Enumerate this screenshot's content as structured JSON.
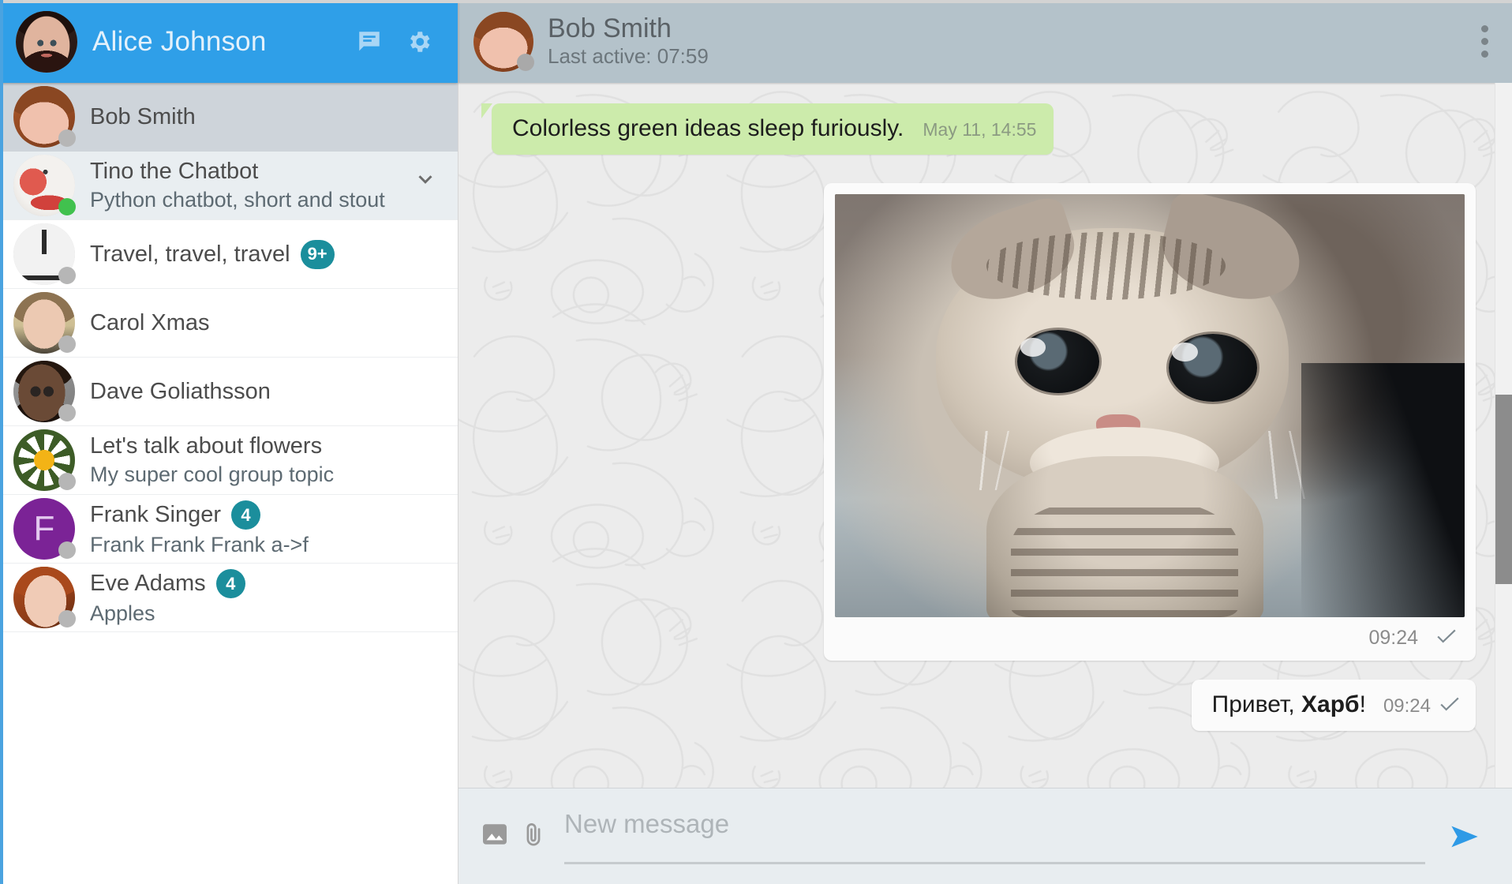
{
  "sidebar": {
    "header": {
      "user_name": "Alice Johnson",
      "new_chat_icon": "chat-bubble-icon",
      "settings_icon": "gear-icon"
    },
    "chats": [
      {
        "name": "Bob Smith",
        "subtitle": "",
        "badge": "",
        "status": "offline",
        "selected": true,
        "avatar_kind": "photo-bob",
        "chevron": false
      },
      {
        "name": "Tino the Chatbot",
        "subtitle": "Python chatbot, short and stout",
        "badge": "",
        "status": "online",
        "selected": false,
        "avatar_kind": "photo-clown",
        "chevron": true
      },
      {
        "name": "Travel, travel, travel",
        "subtitle": "",
        "badge": "9+",
        "status": "offline",
        "selected": false,
        "avatar_kind": "photo-eiffel",
        "chevron": false
      },
      {
        "name": "Carol Xmas",
        "subtitle": "",
        "badge": "",
        "status": "offline",
        "selected": false,
        "avatar_kind": "photo-carol",
        "chevron": false
      },
      {
        "name": "Dave Goliathsson",
        "subtitle": "",
        "badge": "",
        "status": "offline",
        "selected": false,
        "avatar_kind": "photo-dave",
        "chevron": false
      },
      {
        "name": "Let's talk about flowers",
        "subtitle": "My super cool group topic",
        "badge": "",
        "status": "offline",
        "selected": false,
        "avatar_kind": "photo-flower",
        "chevron": false
      },
      {
        "name": "Frank Singer",
        "subtitle": "Frank Frank Frank a->f",
        "badge": "4",
        "status": "offline",
        "selected": false,
        "avatar_kind": "letter-F",
        "chevron": false
      },
      {
        "name": "Eve Adams",
        "subtitle": "Apples",
        "badge": "4",
        "status": "offline",
        "selected": false,
        "avatar_kind": "photo-eve",
        "chevron": false
      }
    ]
  },
  "chat": {
    "header": {
      "title": "Bob Smith",
      "status": "Last active: 07:59",
      "menu_icon": "kebab-menu-icon"
    },
    "messages": [
      {
        "id": "m1",
        "direction": "in",
        "type": "text",
        "text": "Colorless green ideas sleep furiously.",
        "time": "May 11, 14:55",
        "read": false
      },
      {
        "id": "m2",
        "direction": "out",
        "type": "photo",
        "text": "",
        "time": "09:24",
        "read": true,
        "alt": "kitten-photo"
      },
      {
        "id": "m3",
        "direction": "out",
        "type": "text",
        "text_plain": "Привет, ",
        "text_bold": "Харб",
        "text_tail": "!",
        "time": "09:24",
        "read": true
      }
    ],
    "composer": {
      "placeholder": "New message",
      "value": "",
      "image_icon": "image-icon",
      "attach_icon": "paperclip-icon",
      "send_icon": "send-icon"
    }
  },
  "colors": {
    "accent": "#2f9fe8",
    "header_chat": "#b4c2ca",
    "badge": "#1b8e9c",
    "bubble_in": "#ccebab",
    "bubble_out": "#fbfbfb",
    "online": "#41c14e",
    "selected_row": "#ced4da"
  }
}
